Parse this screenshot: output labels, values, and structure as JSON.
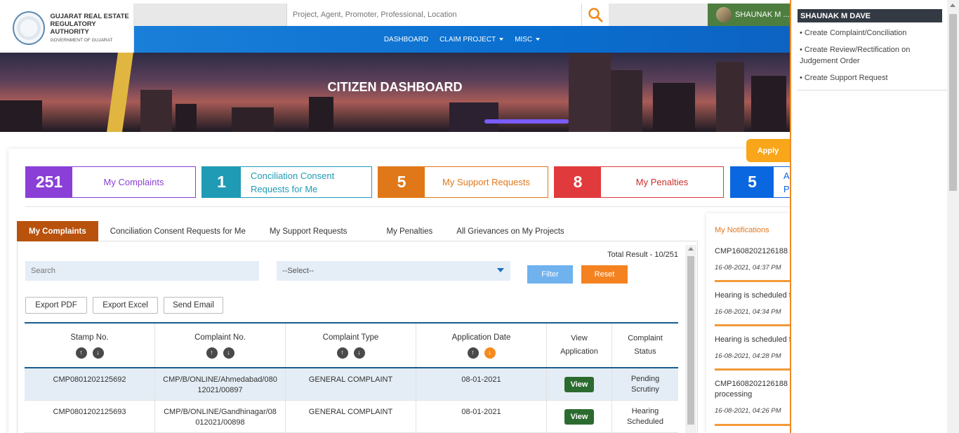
{
  "header": {
    "org_line1": "GUJARAT REAL ESTATE",
    "org_line2": "REGULATORY AUTHORITY",
    "org_line3": "GOVERNMENT OF GUJARAT",
    "search_placeholder": "Project, Agent, Promoter, Professional, Location",
    "user_name": "SHAUNAK M ..."
  },
  "nav": {
    "items": [
      {
        "label": "DASHBOARD"
      },
      {
        "label": "CLAIM PROJECT"
      },
      {
        "label": "MISC"
      }
    ]
  },
  "banner": {
    "title": "CITIZEN DASHBOARD"
  },
  "apply_label": "Apply",
  "stats": [
    {
      "count": "251",
      "label": "My Complaints",
      "color": "#8a3fd6"
    },
    {
      "count": "1",
      "label_line1": "Conciliation Consent",
      "label_line2": "Requests for Me",
      "color": "#1f9bb5"
    },
    {
      "count": "5",
      "label": "My Support Requests",
      "color": "#e0781a"
    },
    {
      "count": "8",
      "label": "My Penalties",
      "color": "#e03a3c"
    },
    {
      "count": "5",
      "label_line1": "A",
      "label_line2": "P",
      "color": "#0b67e0"
    }
  ],
  "tabs": [
    {
      "label": "My Complaints"
    },
    {
      "label": "Conciliation Consent Requests for Me"
    },
    {
      "label": "My Support Requests"
    },
    {
      "label": "My Penalties"
    },
    {
      "label": "All Grievances on My Projects"
    }
  ],
  "filters": {
    "search_placeholder": "Search",
    "select_value": "--Select--",
    "filter_label": "Filter",
    "reset_label": "Reset",
    "total": "Total Result - 10/251"
  },
  "exports": {
    "pdf": "Export PDF",
    "excel": "Export Excel",
    "email": "Send Email"
  },
  "table": {
    "headers": {
      "stamp": "Stamp No.",
      "complaint_no": "Complaint No.",
      "type": "Complaint Type",
      "date": "Application Date",
      "view_l1": "View",
      "view_l2": "Application",
      "status_l1": "Complaint",
      "status_l2": "Status"
    },
    "rows": [
      {
        "stamp": "CMP0801202125692",
        "no_l1": "CMP/B/ONLINE/Ahmedabad/080",
        "no_l2": "12021/00897",
        "type": "GENERAL COMPLAINT",
        "date": "08-01-2021",
        "view": "View",
        "status_l1": "Pending",
        "status_l2": "Scrutiny"
      },
      {
        "stamp": "CMP0801202125693",
        "no_l1": "CMP/B/ONLINE/Gandhinagar/08",
        "no_l2": "012021/00898",
        "type": "GENERAL COMPLAINT",
        "date": "08-01-2021",
        "view": "View",
        "status_l1": "Hearing",
        "status_l2": "Scheduled"
      }
    ]
  },
  "notifications": {
    "title": "My Notifications",
    "items": [
      {
        "text": "CMP1608202126188",
        "date": "16-08-2021, 04:37 PM"
      },
      {
        "text": "Hearing is scheduled f",
        "date": "16-08-2021, 04:34 PM"
      },
      {
        "text": "Hearing is scheduled f",
        "date": "16-08-2021, 04:28 PM"
      },
      {
        "text": "CMP1608202126188",
        "text2": "processing",
        "date": "16-08-2021, 04:26 PM"
      }
    ]
  },
  "user_menu": {
    "name": "SHAUNAK M DAVE",
    "items": [
      {
        "label": "• Create Complaint/Conciliation"
      },
      {
        "label": "• Create Review/Rectification on Judgement Order"
      },
      {
        "label": "• Create Support Request"
      }
    ]
  }
}
